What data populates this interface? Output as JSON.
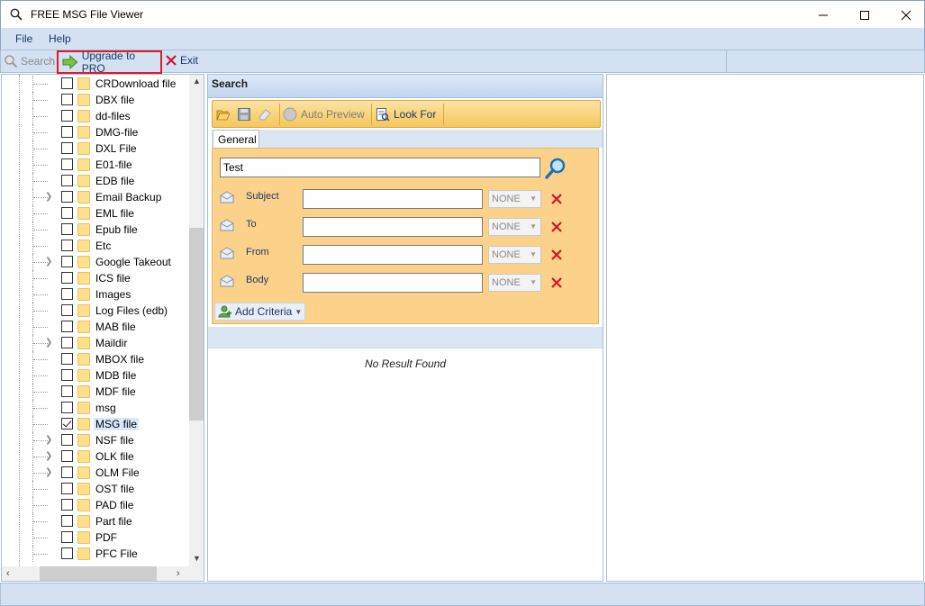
{
  "window": {
    "title": "FREE MSG File Viewer",
    "icon": "search-icon"
  },
  "menu": {
    "file": "File",
    "help": "Help"
  },
  "toolbar": {
    "search_label": "Search",
    "upgrade_label": "Upgrade to PRO",
    "exit_label": "Exit"
  },
  "tree": {
    "items": [
      {
        "label": "CRDownload file",
        "checked": false,
        "expandable": false
      },
      {
        "label": "DBX file",
        "checked": false,
        "expandable": false
      },
      {
        "label": "dd-files",
        "checked": false,
        "expandable": false
      },
      {
        "label": "DMG-file",
        "checked": false,
        "expandable": false
      },
      {
        "label": "DXL File",
        "checked": false,
        "expandable": false
      },
      {
        "label": "E01-file",
        "checked": false,
        "expandable": false
      },
      {
        "label": "EDB file",
        "checked": false,
        "expandable": false
      },
      {
        "label": "Email Backup",
        "checked": false,
        "expandable": true
      },
      {
        "label": "EML file",
        "checked": false,
        "expandable": false
      },
      {
        "label": "Epub file",
        "checked": false,
        "expandable": false
      },
      {
        "label": "Etc",
        "checked": false,
        "expandable": false
      },
      {
        "label": "Google Takeout",
        "checked": false,
        "expandable": true
      },
      {
        "label": "ICS file",
        "checked": false,
        "expandable": false
      },
      {
        "label": "Images",
        "checked": false,
        "expandable": false
      },
      {
        "label": "Log Files (edb)",
        "checked": false,
        "expandable": false
      },
      {
        "label": "MAB file",
        "checked": false,
        "expandable": false
      },
      {
        "label": "Maildir",
        "checked": false,
        "expandable": true
      },
      {
        "label": "MBOX file",
        "checked": false,
        "expandable": false
      },
      {
        "label": "MDB file",
        "checked": false,
        "expandable": false
      },
      {
        "label": "MDF file",
        "checked": false,
        "expandable": false
      },
      {
        "label": "msg",
        "checked": false,
        "expandable": false
      },
      {
        "label": "MSG file",
        "checked": true,
        "expandable": false,
        "selected": true
      },
      {
        "label": "NSF file",
        "checked": false,
        "expandable": true
      },
      {
        "label": "OLK file",
        "checked": false,
        "expandable": true
      },
      {
        "label": "OLM File",
        "checked": false,
        "expandable": true
      },
      {
        "label": "OST file",
        "checked": false,
        "expandable": false
      },
      {
        "label": "PAD file",
        "checked": false,
        "expandable": false
      },
      {
        "label": "Part file",
        "checked": false,
        "expandable": false
      },
      {
        "label": "PDF",
        "checked": false,
        "expandable": false
      },
      {
        "label": "PFC File",
        "checked": false,
        "expandable": false
      }
    ]
  },
  "search": {
    "header": "Search",
    "toolbar": {
      "auto_preview": "Auto Preview",
      "look_for": "Look For"
    },
    "tab_general": "General",
    "query_value": "Test",
    "criteria": [
      {
        "label": "Subject",
        "value": "",
        "operator": "NONE"
      },
      {
        "label": "To",
        "value": "",
        "operator": "NONE"
      },
      {
        "label": "From",
        "value": "",
        "operator": "NONE"
      },
      {
        "label": "Body",
        "value": "",
        "operator": "NONE"
      }
    ],
    "add_criteria": "Add Criteria",
    "no_result": "No Result Found"
  },
  "colors": {
    "accent": "#1e3966",
    "highlight_border": "#e0192c",
    "criteria_bg": "#fcd28a"
  }
}
